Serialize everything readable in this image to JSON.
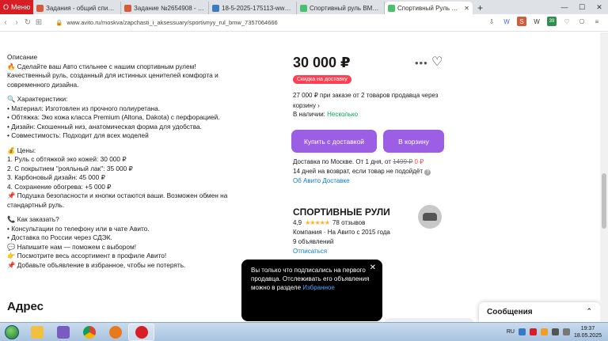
{
  "browser": {
    "menu_label": "Меню",
    "tabs": [
      {
        "title": "Задания - общий список -",
        "fav_color": "#d8583a",
        "fav_char": "SP"
      },
      {
        "title": "Задание №2654908 - про",
        "fav_color": "#d8583a",
        "fav_char": "SP"
      },
      {
        "title": "18-5-2025-175113-www-a",
        "fav_color": "#3b7bbf",
        "fav_char": "BM"
      },
      {
        "title": "Спортивный руль BMW -",
        "fav_color": "#4bbf6b",
        "fav_char": ""
      },
      {
        "title": "Спортивный Руль BMW с",
        "fav_color": "#4bbf6b",
        "fav_char": ""
      }
    ],
    "new_tab": "+",
    "url": "www.avito.ru/moskva/zapchasti_i_aksessuary/sportivnyy_rul_bmw_7357064666",
    "ext_badge": "39"
  },
  "description": {
    "heading": "Описание",
    "intro": "🔥 Сделайте ваш Авто стильнее с нашим спортивным рулем!\nКачественный руль, созданный для истинных ценителей комфорта и современного дизайна.",
    "features_heading": "🔍 Характеристики:",
    "features": [
      "• Материал: Изготовлен из прочного полиуретана.",
      "• Обтяжка: Эко кожа класса Premium (Altona, Dakota) с перфорацией.",
      "• Дизайн: Скошенный низ, анатомическая форма для удобства.",
      "• Совместимость: Подходит для всех моделей"
    ],
    "prices_heading": "💰 Цены:",
    "prices": [
      "1. Руль с обтяжкой эко кожей: 30 000 ₽",
      "2. С покрытием \"рояльный лак\": 35 000 ₽",
      "3. Карбоновый дизайн: 45 000 ₽",
      "4. Сохранение обогрева: +5 000 ₽",
      "📌 Подушка безопасности и кнопки остаются ваши. Возможен обмен на стандартный руль."
    ],
    "order_heading": "📞 Как заказать?",
    "order": [
      "• Консультации по телефону или в чате Авито.",
      "• Доставка по России через СДЭК.",
      "💬 Напишите нам — поможем с выбором!",
      "👉 Посмотрите весь ассортимент в профиле Авито!",
      "📌 Добавьте объявление в избранное, чтобы не потерять."
    ]
  },
  "address_heading": "Адрес",
  "offer": {
    "price": "30 000 ₽",
    "badge": "Скидка на доставку",
    "bundle": "27 000 ₽ при заказе от 2 товаров продавца через корзину ›",
    "stock_label": "В наличии:",
    "stock_value": "Несколько",
    "buy_button": "Купить с доставкой",
    "cart_button": "В корзину",
    "delivery_line": "Доставка по Москве. От 1 дня, от",
    "delivery_old": "1499 ₽",
    "delivery_new": "0 ₽",
    "return_line": "14 дней на возврат, если товар не подойдёт",
    "delivery_link": "Об Авито Доставке"
  },
  "seller": {
    "name": "СПОРТИВНЫЕ РУЛИ",
    "rating": "4,9",
    "stars": "★★★★★",
    "reviews": "78 отзывов",
    "since": "Компания · На Авито с 2015 года",
    "ads": "9 объявлений",
    "subscribed": "Отписаться"
  },
  "toast": {
    "text": "Вы только что подписались на первого продавца. Отслеживать его объявления можно в разделе",
    "link": "Избранное"
  },
  "messages": {
    "label": "Сообщения"
  },
  "taskbar": {
    "lang": "RU",
    "time": "19:37",
    "date": "18.05.2025",
    "apps": [
      "#3a77c9",
      "#f0c040",
      "#7a5bbf",
      "#2f9c46",
      "#e87a1e",
      "#d81e25"
    ]
  }
}
